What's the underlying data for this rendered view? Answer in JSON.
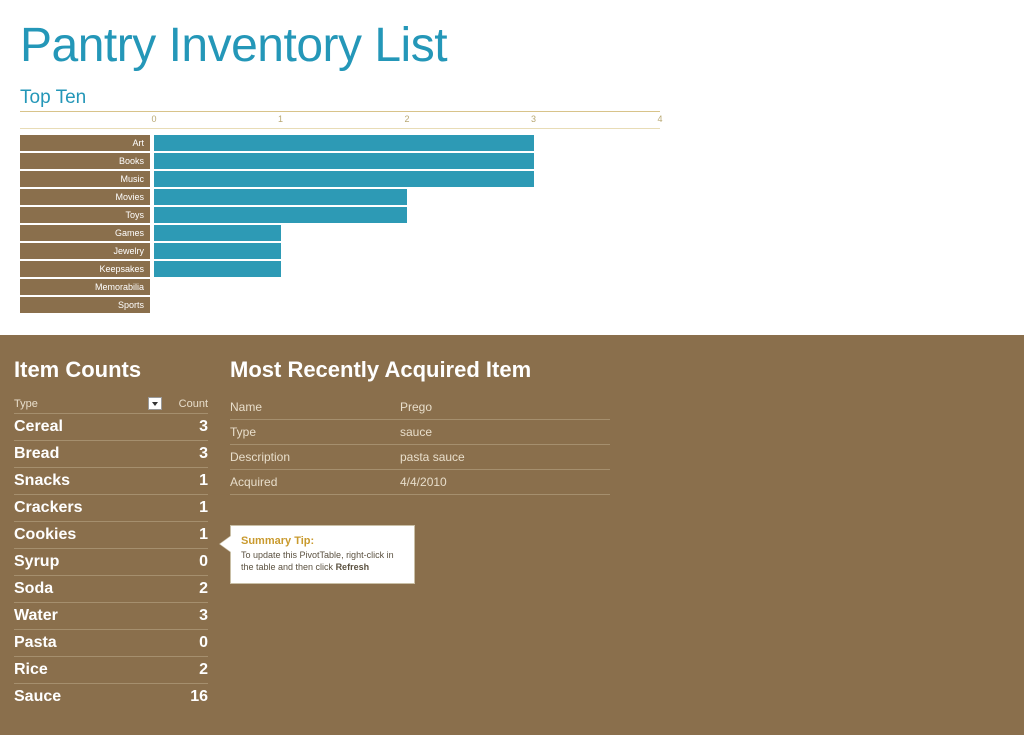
{
  "title": "Pantry Inventory List",
  "chart_data": {
    "type": "bar",
    "title": "Top Ten",
    "orientation": "horizontal",
    "categories": [
      "Art",
      "Books",
      "Music",
      "Movies",
      "Toys",
      "Games",
      "Jewelry",
      "Keepsakes",
      "Memorabilia",
      "Sports"
    ],
    "values": [
      3,
      3,
      3,
      2,
      2,
      1,
      1,
      1,
      0,
      0
    ],
    "xlabel": "",
    "ylabel": "",
    "xlim": [
      0,
      4
    ],
    "ticks": [
      0,
      1,
      2,
      3,
      4
    ],
    "bar_color": "#2d9ab5",
    "label_bg": "#8a6f4c"
  },
  "item_counts": {
    "heading": "Item Counts",
    "col_type": "Type",
    "col_count": "Count",
    "rows": [
      {
        "type": "Cereal",
        "count": 3
      },
      {
        "type": "Bread",
        "count": 3
      },
      {
        "type": "Snacks",
        "count": 1
      },
      {
        "type": "Crackers",
        "count": 1
      },
      {
        "type": "Cookies",
        "count": 1
      },
      {
        "type": "Syrup",
        "count": 0
      },
      {
        "type": "Soda",
        "count": 2
      },
      {
        "type": "Water",
        "count": 3
      },
      {
        "type": "Pasta",
        "count": 0
      },
      {
        "type": "Rice",
        "count": 2
      },
      {
        "type": "Sauce",
        "count": 16
      }
    ]
  },
  "recent": {
    "heading": "Most Recently Acquired Item",
    "rows": [
      {
        "k": "Name",
        "v": "Prego"
      },
      {
        "k": "Type",
        "v": "sauce"
      },
      {
        "k": "Description",
        "v": "pasta sauce"
      },
      {
        "k": "Acquired",
        "v": "4/4/2010"
      }
    ]
  },
  "tip": {
    "title": "Summary Tip:",
    "text_a": "To update this PivotTable, right-click in the table and then click ",
    "text_b": "Refresh"
  }
}
